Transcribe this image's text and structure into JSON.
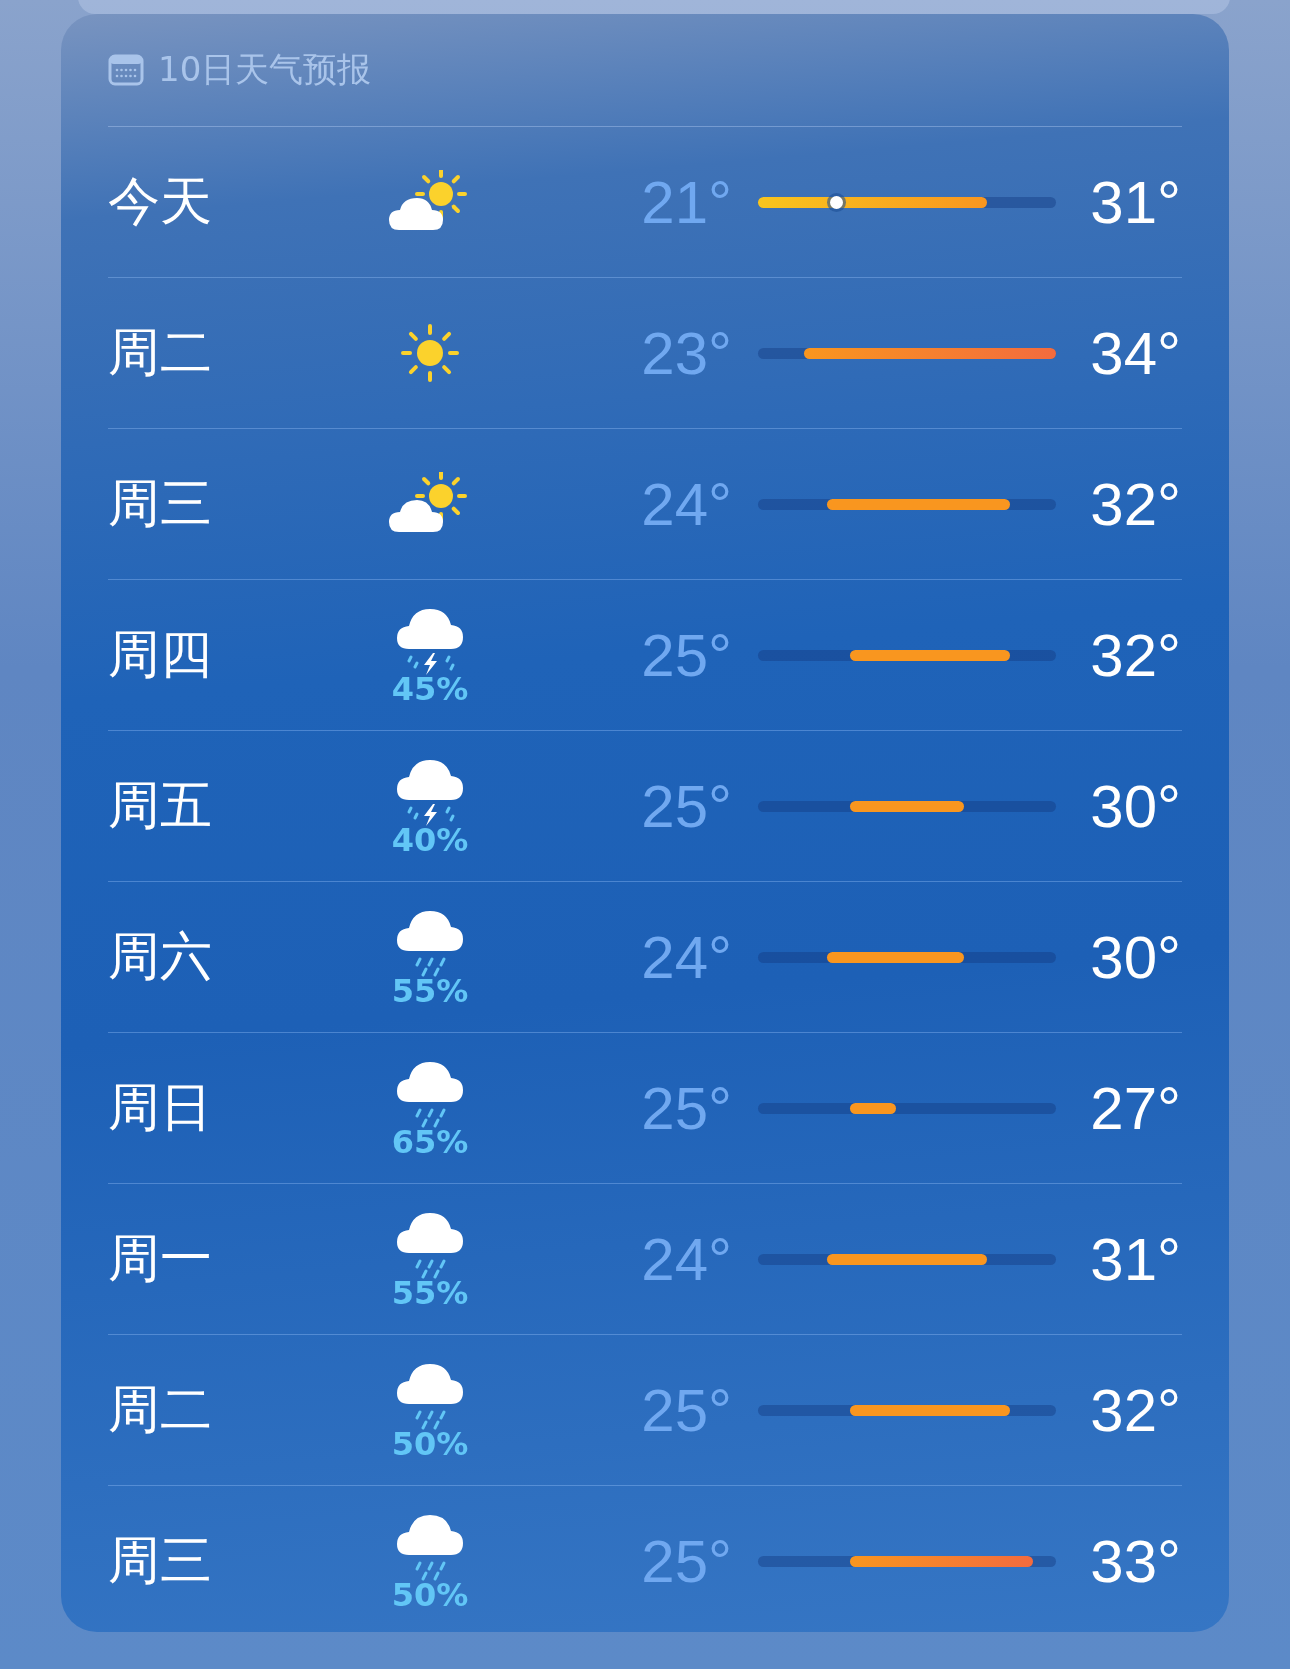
{
  "forecast": {
    "title": "10日天气预报",
    "days": [
      {
        "day": "今天",
        "kind": "partly_cloudy",
        "low": "21°",
        "high": "31°",
        "now_marker": {
          "level": 0.34
        }
      },
      {
        "day": "周二",
        "kind": "sunny",
        "low": "23°",
        "high": "34°"
      },
      {
        "day": "周三",
        "kind": "partly_cloudy",
        "low": "24°",
        "high": "32°"
      },
      {
        "day": "周四",
        "kind": "thunderstorm",
        "precip": "45%",
        "low": "25°",
        "high": "32°"
      },
      {
        "day": "周五",
        "kind": "thunderstorm",
        "precip": "40%",
        "low": "25°",
        "high": "30°"
      },
      {
        "day": "周六",
        "kind": "rain",
        "precip": "55%",
        "low": "24°",
        "high": "30°"
      },
      {
        "day": "周日",
        "kind": "rain",
        "precip": "65%",
        "low": "25°",
        "high": "27°"
      },
      {
        "day": "周一",
        "kind": "rain",
        "precip": "55%",
        "low": "24°",
        "high": "31°"
      },
      {
        "day": "周二",
        "kind": "rain",
        "precip": "50%",
        "low": "25°",
        "high": "32°"
      },
      {
        "day": "周三",
        "kind": "rain",
        "precip": "50%",
        "low": "25°",
        "high": "33°"
      }
    ]
  }
}
